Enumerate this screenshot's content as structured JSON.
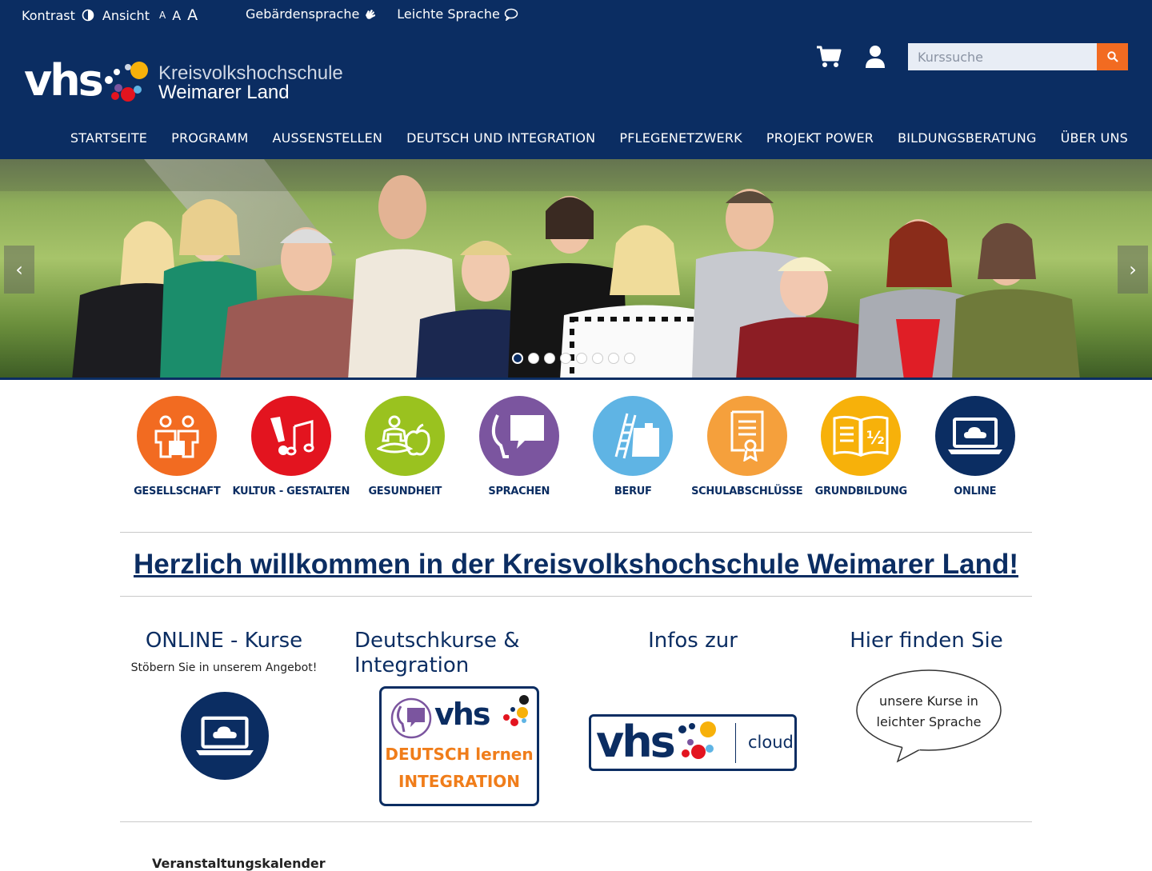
{
  "topbar": {
    "kontrast": "Kontrast",
    "ansicht": "Ansicht",
    "font_small": "A",
    "font_medium": "A",
    "font_large": "A",
    "gebaerdensprache": "Gebärdensprache",
    "leichte_sprache": "Leichte Sprache"
  },
  "logo": {
    "vhs": "vhs",
    "line1": "Kreisvolkshochschule",
    "line2": "Weimarer Land"
  },
  "search": {
    "placeholder": "Kurssuche"
  },
  "nav": {
    "items": [
      "STARTSEITE",
      "PROGRAMM",
      "AUSSENSTELLEN",
      "DEUTSCH UND INTEGRATION",
      "PFLEGENETZWERK",
      "PROJEKT POWER",
      "BILDUNGSBERATUNG",
      "ÜBER UNS"
    ]
  },
  "slider": {
    "prev": "‹",
    "next": "›",
    "slide_count": 8,
    "active_slide": 1
  },
  "categories": [
    {
      "label": "GESELLSCHAFT",
      "color": "#f26b21",
      "icon": "people-icon"
    },
    {
      "label": "KULTUR - GESTALTEN",
      "color": "#e3141f",
      "icon": "music-brush-icon"
    },
    {
      "label": "GESUNDHEIT",
      "color": "#9ac21f",
      "icon": "yoga-apple-icon"
    },
    {
      "label": "SPRACHEN",
      "color": "#7b559f",
      "icon": "speech-icon"
    },
    {
      "label": "BERUF",
      "color": "#5fb4e4",
      "icon": "ladder-briefcase-icon"
    },
    {
      "label": "SCHULABSCHLÜSSE",
      "color": "#f5a03c",
      "icon": "certificate-icon"
    },
    {
      "label": "GRUNDBILDUNG",
      "color": "#f7b10a",
      "icon": "book-half-icon"
    },
    {
      "label": "ONLINE",
      "color": "#0b2d62",
      "icon": "laptop-cloud-icon"
    }
  ],
  "welcome": "Herzlich willkommen in der Kreisvolkshochschule Weimarer Land!",
  "columns": {
    "online": {
      "title": "ONLINE - Kurse",
      "sub": "Stöbern Sie in unserem Angebot!"
    },
    "deutsch": {
      "title": "Deutschkurse & Integration",
      "vhs": "vhs",
      "line1": "DEUTSCH lernen",
      "line2": "INTEGRATION"
    },
    "infos": {
      "title": "Infos zur",
      "vhs": "vhs",
      "cloud": "cloud"
    },
    "hier": {
      "title": "Hier finden Sie",
      "bubble_line1": "unsere Kurse in",
      "bubble_line2": "leichter Sprache"
    }
  },
  "calendar_heading": "Veranstaltungskalender"
}
